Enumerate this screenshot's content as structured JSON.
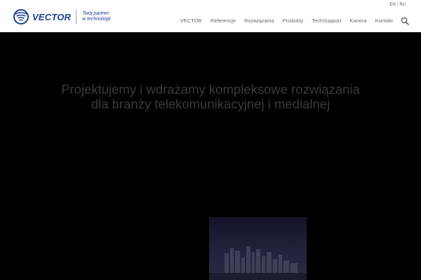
{
  "brand": {
    "name": "VECTOR",
    "tagline_line1": "Twój partner",
    "tagline_line2": "w technologii",
    "color": "#1b3f8f"
  },
  "languages": {
    "en": "EN",
    "separator": "|",
    "ru": "RU"
  },
  "nav": {
    "items": [
      "VECTOR",
      "Referencje",
      "Rozwiązania",
      "Produkty",
      "TechSupport",
      "Kariera",
      "Kontakt"
    ],
    "search_icon": "search-icon"
  },
  "hero": {
    "title_line1": "Projektujemy i wdrażamy kompleksowe rozwiązania",
    "title_line2": "dla branży telekomunikacyjnej i medialnej",
    "background_color": "#000000",
    "title_color": "#3a3a3a"
  }
}
